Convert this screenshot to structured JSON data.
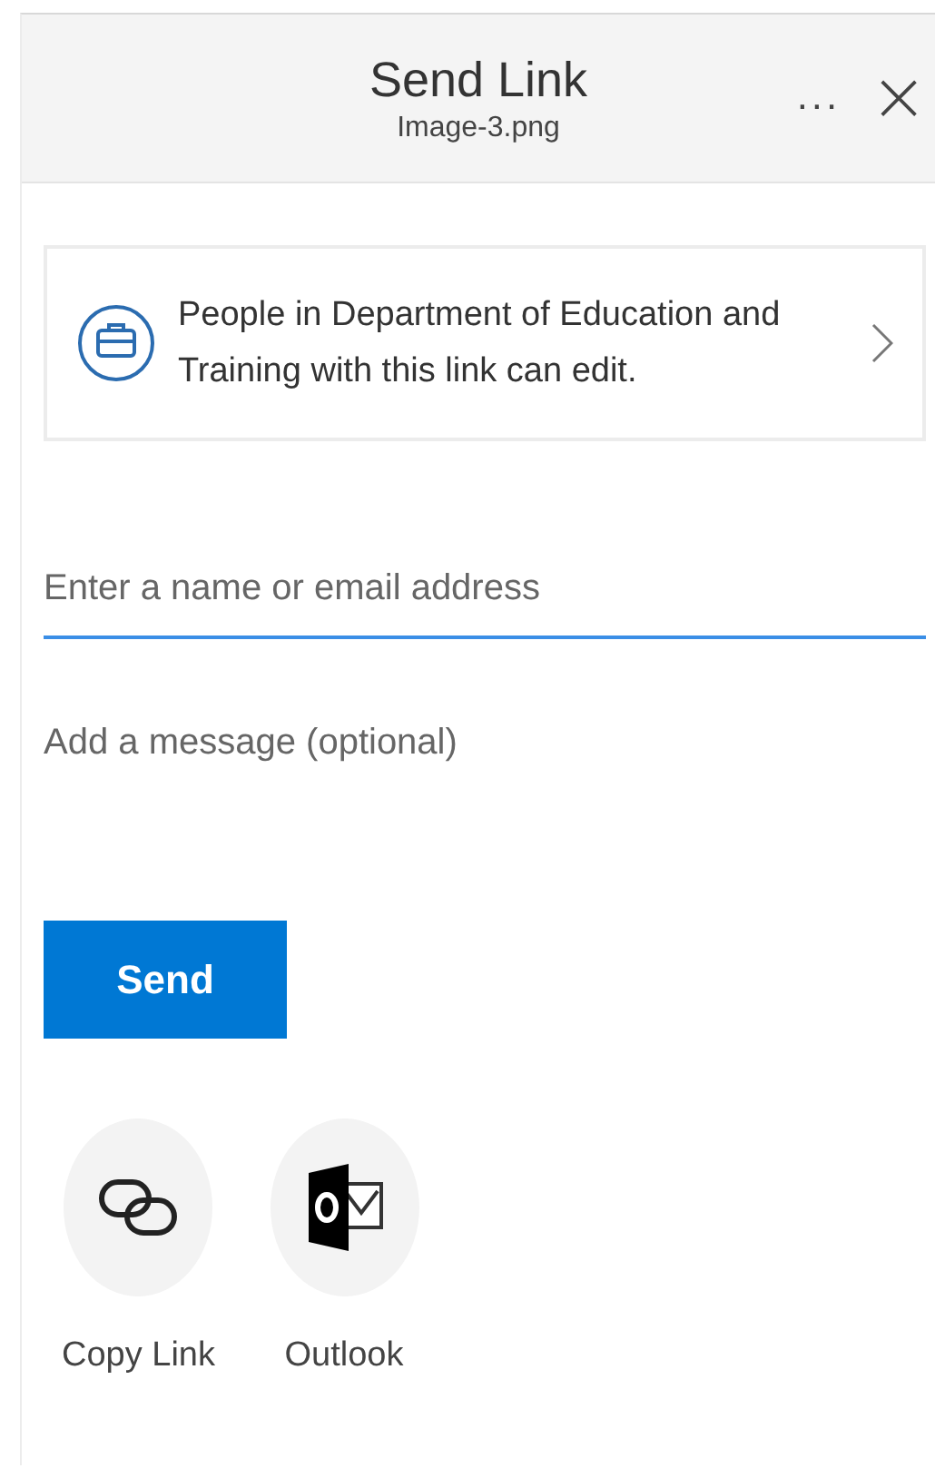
{
  "header": {
    "title": "Send Link",
    "subtitle": "Image-3.png",
    "more": "...",
    "close": "×"
  },
  "permission": {
    "text": "People in Department of Education and Training with this link can edit."
  },
  "recipient": {
    "placeholder": "Enter a name or email address",
    "focused": true
  },
  "message": {
    "placeholder": "Add a message (optional)"
  },
  "send_button": "Send",
  "share_options": [
    {
      "kind": "copy-link",
      "label": "Copy Link"
    },
    {
      "kind": "outlook",
      "label": "Outlook"
    }
  ]
}
